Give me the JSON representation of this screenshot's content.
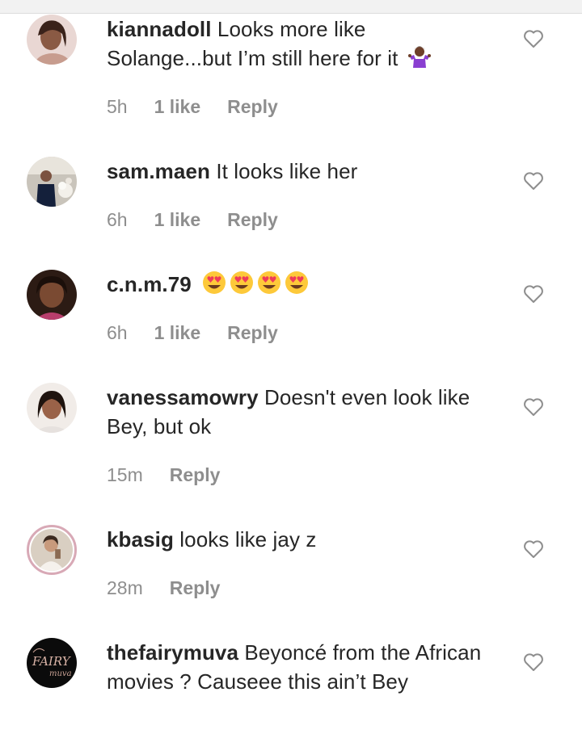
{
  "comments": [
    {
      "username": "kiannadoll",
      "text": "Looks more like Solange...but I’m still here for it",
      "emoji": "person-shrugging-emoji",
      "time": "5h",
      "likes": "1 like",
      "reply": "Reply"
    },
    {
      "username": "sam.maen",
      "text": "It looks like her",
      "time": "6h",
      "likes": "1 like",
      "reply": "Reply"
    },
    {
      "username": "c.n.m.79",
      "text": "",
      "emoji": "smiling-face-with-heart-eyes-x4",
      "time": "6h",
      "likes": "1 like",
      "reply": "Reply"
    },
    {
      "username": "vanessamowry",
      "text": "Doesn't even look like Bey, but ok",
      "time": "15m",
      "likes": "",
      "reply": "Reply"
    },
    {
      "username": "kbasig",
      "text": "looks like jay z",
      "time": "28m",
      "likes": "",
      "reply": "Reply"
    },
    {
      "username": "thefairymuva",
      "text": "Beyoncé from the African movies ? Causeee this ain’t Bey",
      "time": "",
      "likes": "",
      "reply": ""
    }
  ],
  "icons": {
    "like": "heart-outline-icon"
  },
  "colors": {
    "text": "#262626",
    "meta": "#8e8e8e",
    "background": "#ffffff"
  }
}
